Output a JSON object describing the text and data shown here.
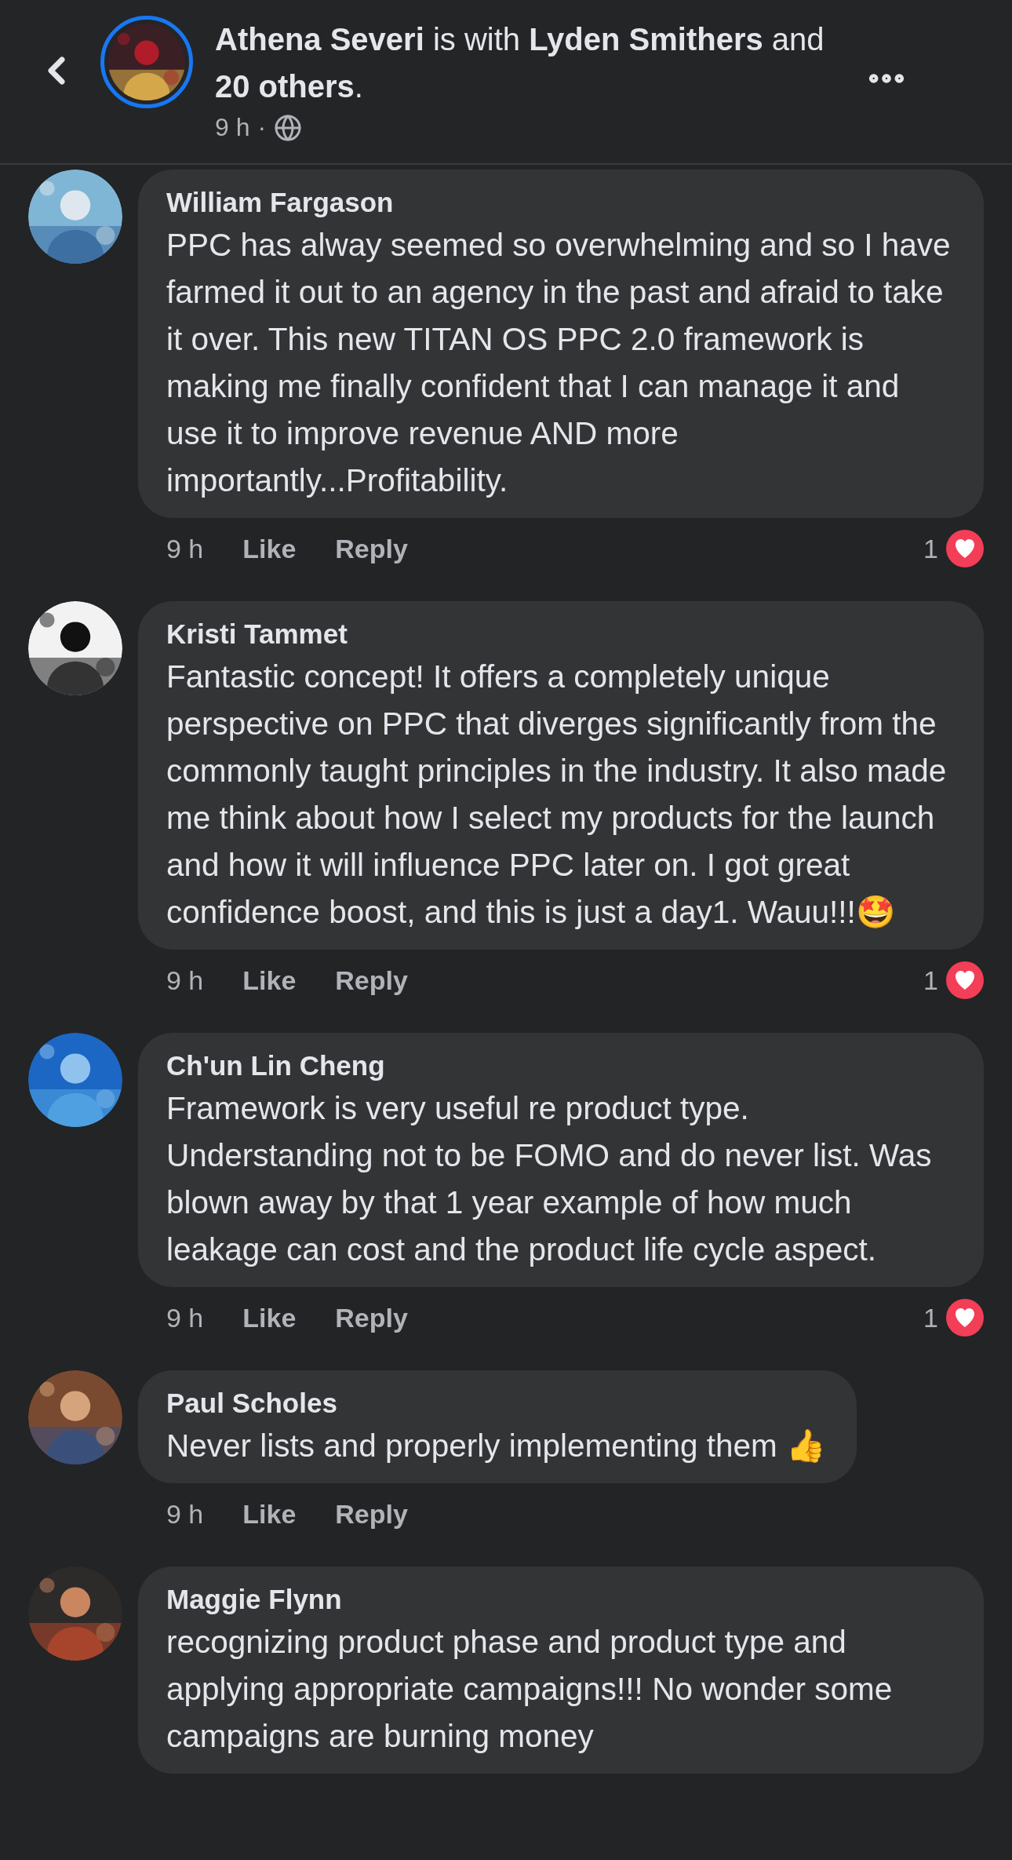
{
  "header": {
    "title": "**Athena Severi** is with **Lyden Smithers** and **20 others**.",
    "time": "9 h",
    "separator": "·"
  },
  "comments": [
    {
      "author": "William Fargason",
      "text": "PPC has alway seemed so overwhelming and so I have farmed it out to an agency in the past and afraid to take it over. This new TITAN OS PPC 2.0 framework is making me finally confident that I can manage it and use it to improve revenue AND more importantly...Profitability.",
      "time": "9 h",
      "actions": [
        "Like",
        "Reply"
      ],
      "reaction_count": "1"
    },
    {
      "author": "Kristi Tammet",
      "text": "Fantastic concept! It offers a completely unique perspective on PPC that diverges significantly from the commonly taught principles in the industry. It also made me think about how I select my products for the launch and how it will influence PPC later on. I got great confidence boost, and this is just a day1. Wauu!!!🤩",
      "time": "9 h",
      "actions": [
        "Like",
        "Reply"
      ],
      "reaction_count": "1"
    },
    {
      "author": "Ch'un Lin Cheng",
      "text": "Framework is very useful re product type. Understanding not to be FOMO and do never list. Was blown away by that 1 year example of how much leakage can cost and the product life cycle aspect.",
      "time": "9 h",
      "actions": [
        "Like",
        "Reply"
      ],
      "reaction_count": "1"
    },
    {
      "author": "Paul Scholes",
      "text": "Never lists and properly implementing them 👍",
      "time": "9 h",
      "actions": [
        "Like",
        "Reply"
      ]
    },
    {
      "author": "Maggie Flynn",
      "text": "recognizing product phase and product type and applying appropriate campaigns!!! No wonder some campaigns are burning money"
    }
  ]
}
